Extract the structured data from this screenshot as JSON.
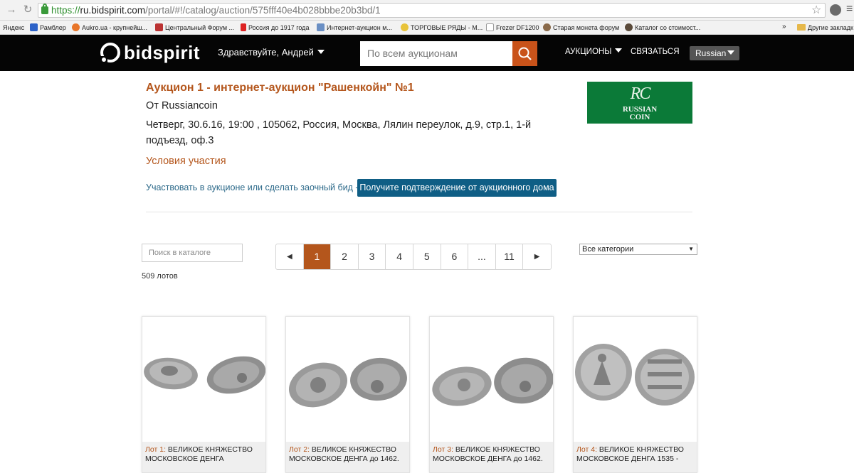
{
  "browser": {
    "url_https": "https://",
    "url_host": "ru.bidspirit.com",
    "url_path": "/portal/#!/catalog/auction/575fff40e4b028bbbe20b3bd/1",
    "bookmarks": [
      "Яндекс",
      "Рамблер",
      "Aukro.ua - крупнейш...",
      "Центральный Форум ...",
      "Россия до 1917 года",
      "Интернет-аукцион м...",
      "ТОРГОВЫЕ РЯДЫ - М...",
      "Frezer DF1200",
      "Старая монета форум",
      "Каталог со стоимост..."
    ],
    "bookmarks_more": "»",
    "other_bookmarks": "Другие закладк"
  },
  "header": {
    "logo": "bidspirit",
    "greeting": "Здравствуйте, Андрей",
    "search_placeholder": "По всем аукционам",
    "nav_auctions": "АУКЦИОНЫ",
    "nav_contact": "СВЯЗАТЬСЯ",
    "language": "Russian"
  },
  "auction": {
    "title": "Аукцион 1 - интернет-аукцион \"Рашенкойн\" №1",
    "from": "От Russiancoin",
    "when": "Четверг, 30.6.16, 19:00 , 105062, Россия, Москва, Лялин переулок, д.9, стр.1, 1-й подъезд, оф.3",
    "conditions": "Условия участия",
    "participate": "Участвовать в аукционе или сделать заочный бид -",
    "confirm_button": "Получите подтверждение от аукционного дома",
    "house_logo_mono": "RC",
    "house_logo_line1": "RUSSIAN",
    "house_logo_line2": "COIN"
  },
  "catalog": {
    "search_placeholder": "Поиск в каталоге",
    "lots_count": "509 лотов",
    "pages": [
      "1",
      "2",
      "3",
      "4",
      "5",
      "6",
      "...",
      "11"
    ],
    "current_page": "1",
    "category": "Все категории"
  },
  "lots": [
    {
      "number": "Лот 1:",
      "title": "ВЕЛИКОЕ КНЯЖЕСТВО МОСКОВСКОЕ ДЕНГА"
    },
    {
      "number": "Лот 2:",
      "title": "ВЕЛИКОЕ КНЯЖЕСТВО МОСКОВСКОЕ ДЕНГА до 1462."
    },
    {
      "number": "Лот 3:",
      "title": "ВЕЛИКОЕ КНЯЖЕСТВО МОСКОВСКОЕ ДЕНГА до 1462."
    },
    {
      "number": "Лот 4:",
      "title": "ВЕЛИКОЕ КНЯЖЕСТВО МОСКОВСКОЕ ДЕНГА 1535 -"
    }
  ],
  "colors": {
    "accent": "#b4561c",
    "header_bg": "#050505",
    "confirm_bg": "#0f5e85",
    "house_logo_bg": "#0b7a38"
  }
}
